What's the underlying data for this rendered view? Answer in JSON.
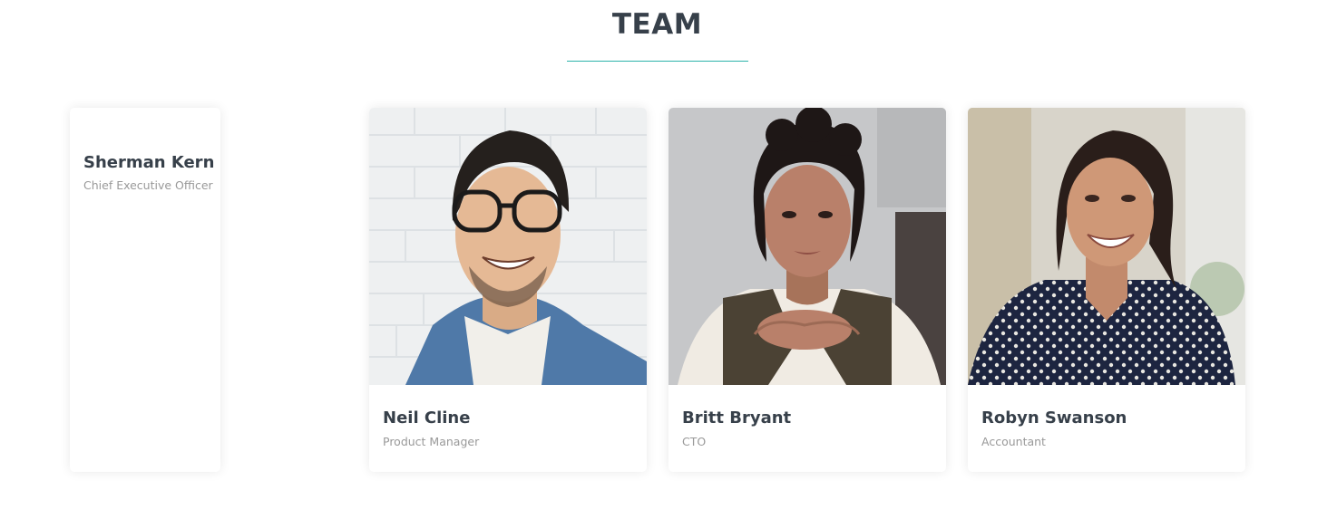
{
  "section": {
    "title": "TEAM",
    "accent_color": "#2bb3aa"
  },
  "members": [
    {
      "name": "Sherman Kern",
      "role": "Chief Executive Officer",
      "photo": "none"
    },
    {
      "name": "Neil Cline",
      "role": "Product Manager",
      "photo": "portrait-man-glasses-denim-shirt"
    },
    {
      "name": "Britt Bryant",
      "role": "CTO",
      "photo": "portrait-woman-curly-hair-hands-clasped"
    },
    {
      "name": "Robyn Swanson",
      "role": "Accountant",
      "photo": "portrait-woman-polka-dot-blouse"
    }
  ]
}
